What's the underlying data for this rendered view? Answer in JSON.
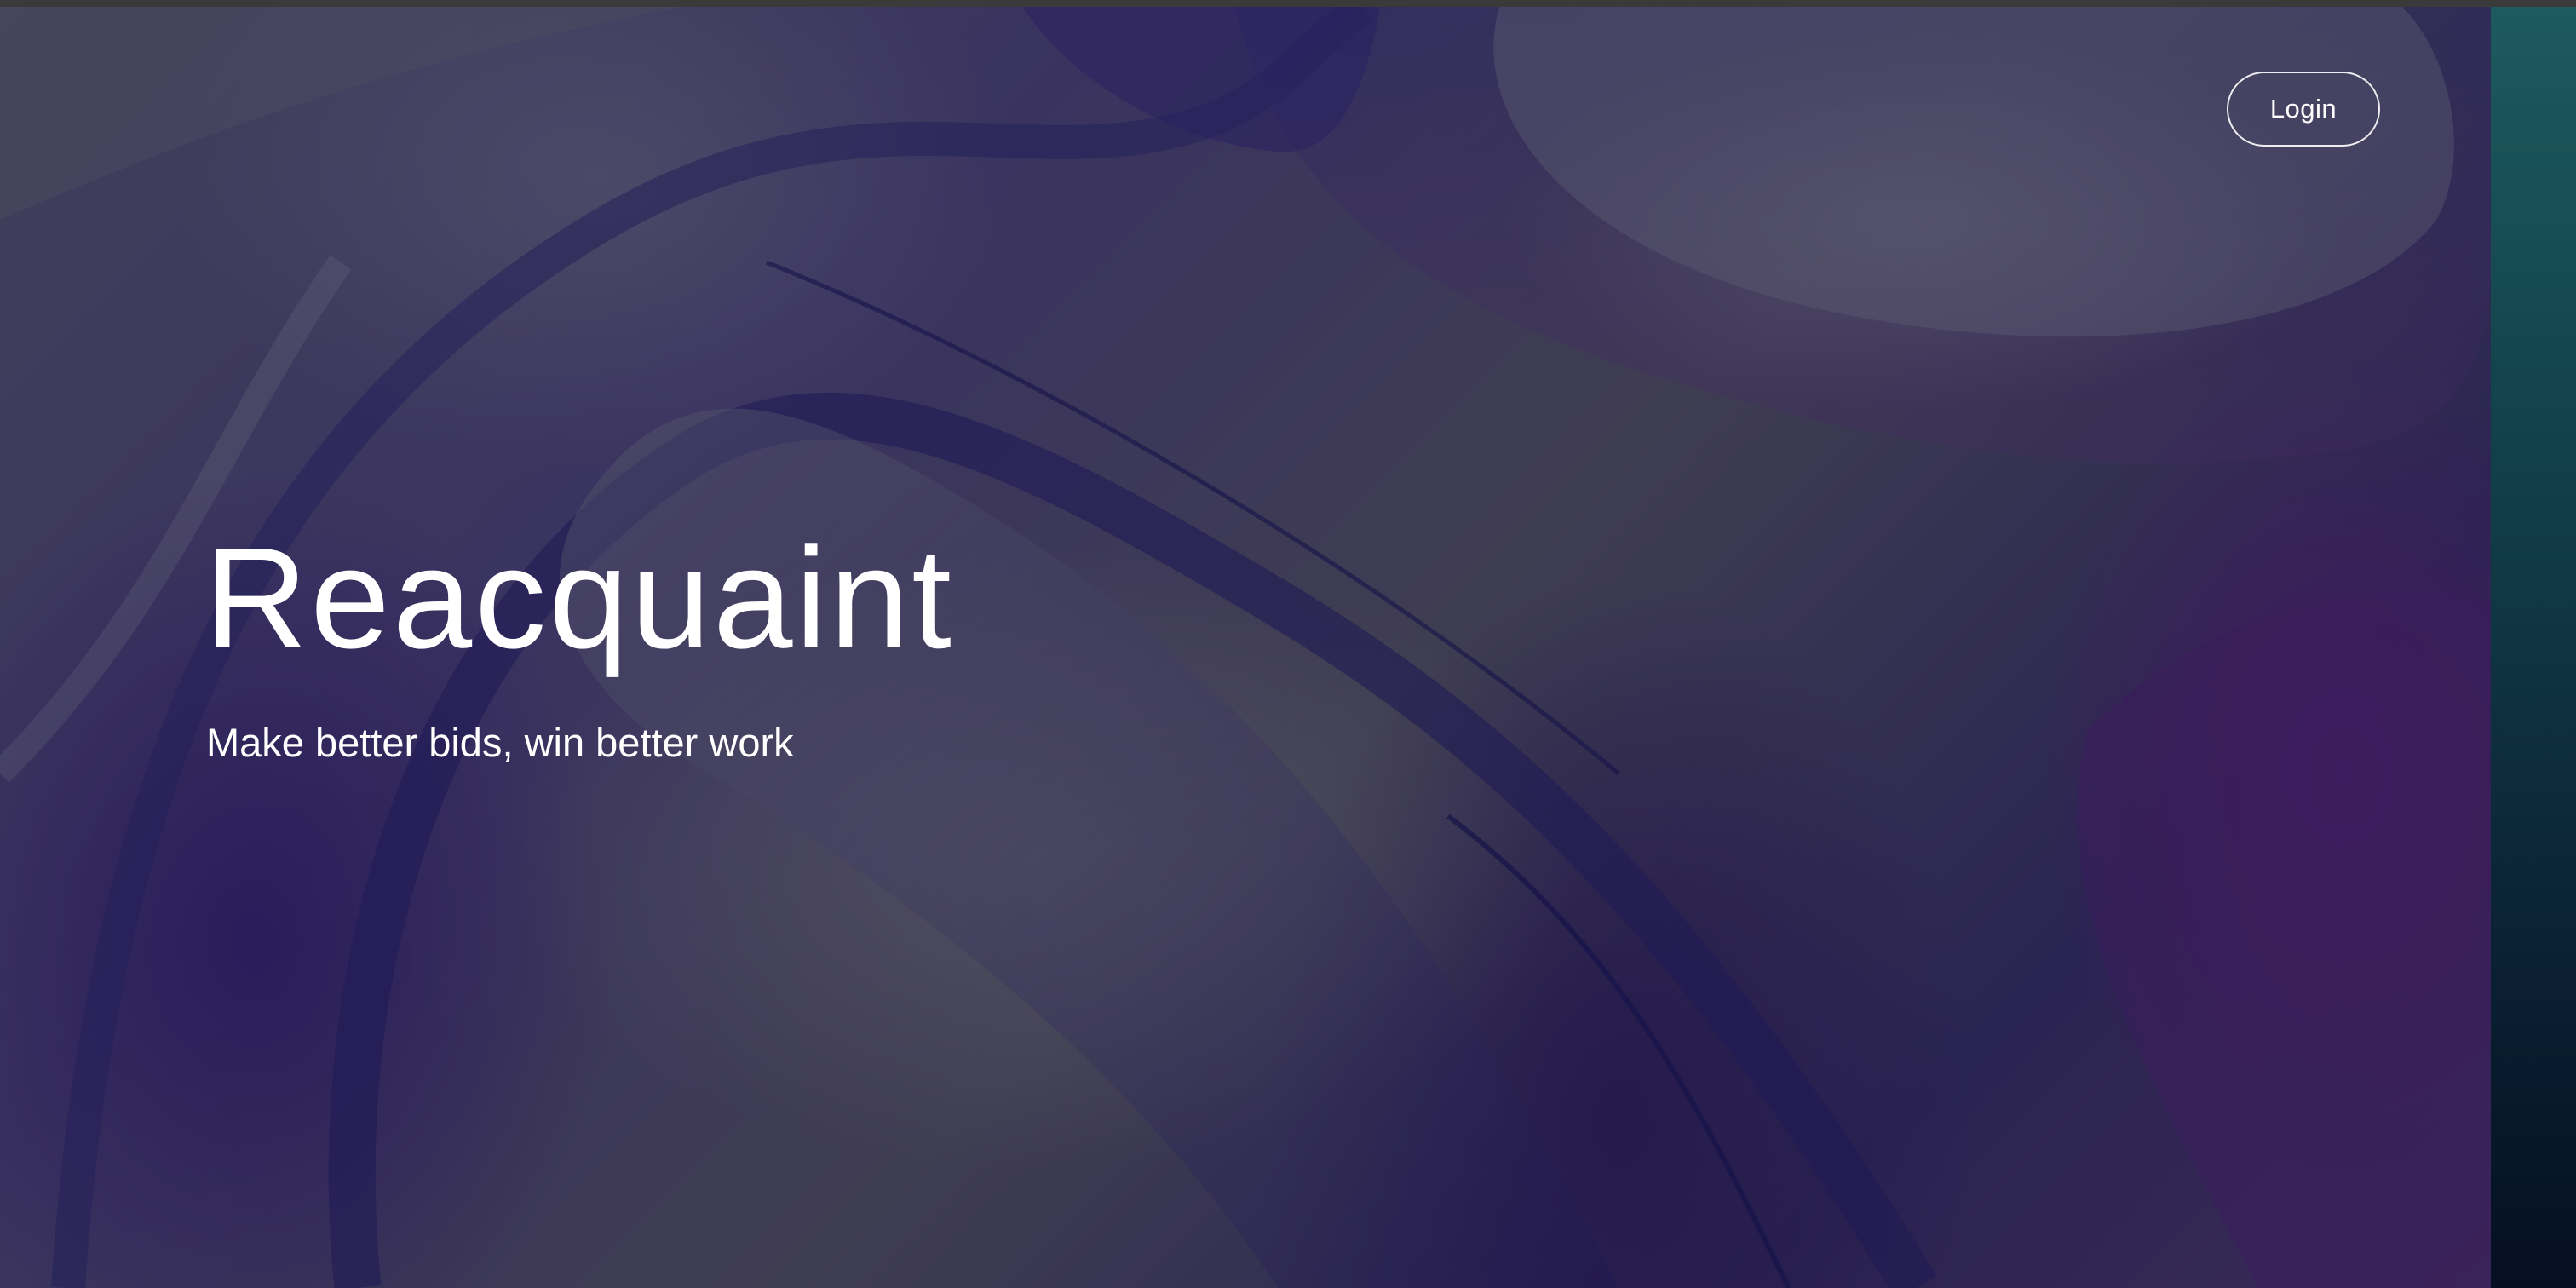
{
  "header": {
    "login_label": "Login"
  },
  "hero": {
    "title": "Reacquaint",
    "tagline": "Make better bids, win better work"
  },
  "theme": {
    "text_color": "#ffffff",
    "background_base": "#3a3360",
    "accent_strip": "#1d5a5f"
  }
}
